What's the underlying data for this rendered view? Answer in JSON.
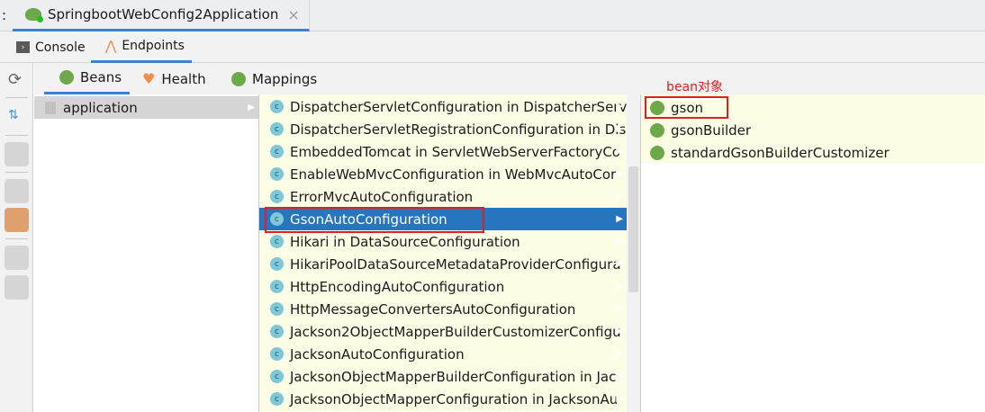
{
  "tab_bar": {
    "prefix": ":",
    "run_tab": "SpringbootWebConfig2Application",
    "close": "×"
  },
  "sub_tabs": [
    {
      "label": "Console"
    },
    {
      "label": "Endpoints"
    }
  ],
  "endpoint_tabs": [
    {
      "label": "Beans"
    },
    {
      "label": "Health"
    },
    {
      "label": "Mappings"
    }
  ],
  "contexts": [
    {
      "label": "application",
      "selected": true
    }
  ],
  "beans": [
    "DispatcherServletConfiguration in DispatcherServ",
    "DispatcherServletRegistrationConfiguration in Dis",
    "EmbeddedTomcat in ServletWebServerFactoryCo",
    "EnableWebMvcConfiguration in WebMvcAutoCor",
    "ErrorMvcAutoConfiguration",
    "GsonAutoConfiguration",
    "Hikari in DataSourceConfiguration",
    "HikariPoolDataSourceMetadataProviderConfigura",
    "HttpEncodingAutoConfiguration",
    "HttpMessageConvertersAutoConfiguration",
    "Jackson2ObjectMapperBuilderCustomizerConfigu",
    "JacksonAutoConfiguration",
    "JacksonObjectMapperBuilderConfiguration in Jac",
    "JacksonObjectMapperConfiguration in JacksonAu"
  ],
  "selected_bean": "GsonAutoConfiguration",
  "bean_icon_letter": "c",
  "bean_objects": [
    "gson",
    "gsonBuilder",
    "standardGsonBuilderCustomizer"
  ],
  "annotation": "bean对象",
  "colors": {
    "selection": "#2675bf",
    "annotation": "#e02020",
    "yellow_bg": "#fefee6",
    "accent": "#3f7fd0"
  }
}
